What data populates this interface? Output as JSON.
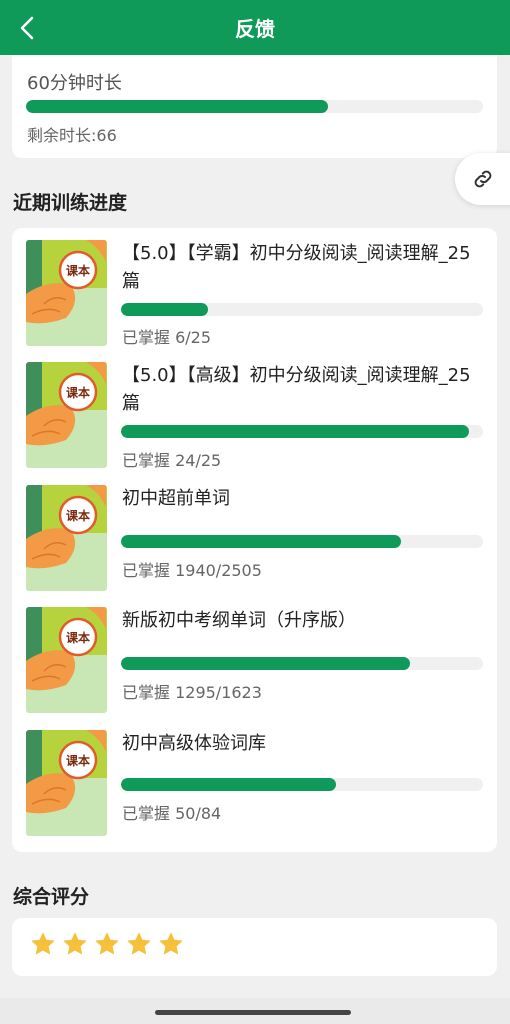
{
  "header": {
    "title": "反馈",
    "bg_color": "#109a5a"
  },
  "duration": {
    "title": "60分钟时长",
    "progress": 0.66,
    "remaining_label": "剩余时长:66"
  },
  "progress_section": {
    "title": "近期训练进度",
    "cover_text": "课本",
    "courses": [
      {
        "title": "【5.0】【学霸】初中分级阅读_阅读理解_25篇",
        "mastered": 6,
        "total": 25,
        "stat": "已掌握 6/25"
      },
      {
        "title": "【5.0】【高级】初中分级阅读_阅读理解_25篇",
        "mastered": 24,
        "total": 25,
        "stat": "已掌握 24/25"
      },
      {
        "title": "初中超前单词",
        "mastered": 1940,
        "total": 2505,
        "stat": "已掌握 1940/2505"
      },
      {
        "title": "新版初中考纲单词（升序版）",
        "mastered": 1295,
        "total": 1623,
        "stat": "已掌握 1295/1623"
      },
      {
        "title": "初中高级体验词库",
        "mastered": 50,
        "total": 84,
        "stat": "已掌握 50/84"
      }
    ]
  },
  "rating": {
    "title": "综合评分",
    "stars": 5,
    "max_stars": 5,
    "star_color": "#f6c13a"
  },
  "icons": {
    "back": "chevron-left-icon",
    "link": "link-icon",
    "star": "star-icon"
  }
}
